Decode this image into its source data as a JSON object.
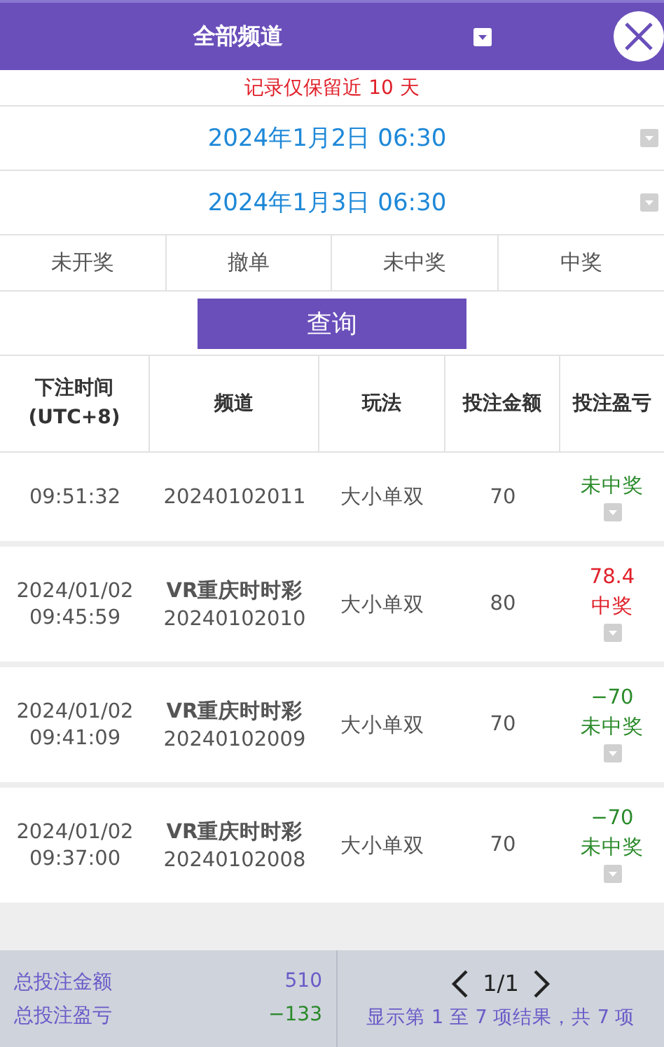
{
  "header": {
    "title": "全部频道"
  },
  "notice": "记录仅保留近 10 天",
  "date_range": [
    "2024年1月2日 06:30",
    "2024年1月3日 06:30"
  ],
  "filters": [
    "未开奖",
    "撤单",
    "未中奖",
    "中奖"
  ],
  "query_button": "查询",
  "table": {
    "columns": [
      [
        "下注时间",
        "(UTC+8)"
      ],
      [
        "频道"
      ],
      [
        "玩法"
      ],
      [
        "投注金额"
      ],
      [
        "投注盈亏"
      ]
    ],
    "rows": [
      {
        "time": "09:51:32",
        "channel_code": "20240102011",
        "play": "大小单双",
        "amount": "70",
        "kind": "loss",
        "outcome": "未中奖"
      },
      {
        "date": "2024/01/02",
        "time": "09:45:59",
        "channel": "VR重庆时时彩",
        "channel_code": "20240102010",
        "play": "大小单双",
        "amount": "80",
        "kind": "win",
        "profit": "78.4",
        "outcome": "中奖"
      },
      {
        "date": "2024/01/02",
        "time": "09:41:09",
        "channel": "VR重庆时时彩",
        "channel_code": "20240102009",
        "play": "大小单双",
        "amount": "70",
        "kind": "loss",
        "profit": "−70",
        "outcome": "未中奖"
      },
      {
        "date": "2024/01/02",
        "time": "09:37:00",
        "channel": "VR重庆时时彩",
        "channel_code": "20240102008",
        "play": "大小单双",
        "amount": "70",
        "kind": "loss",
        "profit": "−70",
        "outcome": "未中奖"
      }
    ]
  },
  "totals": [
    {
      "label": "总投注金额",
      "value": "510",
      "kind": "amount"
    },
    {
      "label": "总投注盈亏",
      "value": "−133",
      "kind": "profit"
    }
  ],
  "pagination": {
    "page": "1/1",
    "summary": "显示第 1 至 7 项结果，共 7 项"
  }
}
